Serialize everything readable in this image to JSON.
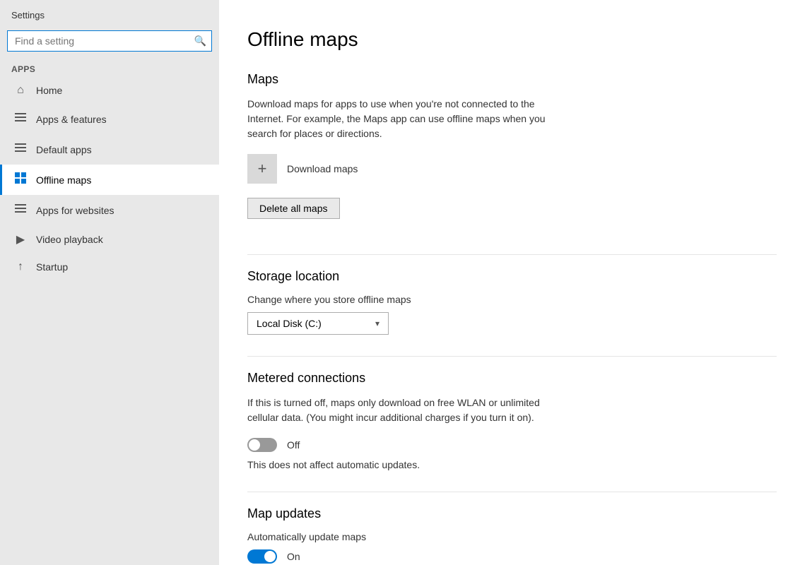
{
  "app": {
    "title": "Settings"
  },
  "sidebar": {
    "search_placeholder": "Find a setting",
    "section_label": "Apps",
    "items": [
      {
        "id": "home",
        "label": "Home",
        "icon": "⌂"
      },
      {
        "id": "apps-features",
        "label": "Apps & features",
        "icon": "☰"
      },
      {
        "id": "default-apps",
        "label": "Default apps",
        "icon": "☰"
      },
      {
        "id": "offline-maps",
        "label": "Offline maps",
        "icon": "⊞",
        "active": true
      },
      {
        "id": "apps-websites",
        "label": "Apps for websites",
        "icon": "☰"
      },
      {
        "id": "video-playback",
        "label": "Video playback",
        "icon": "▶"
      },
      {
        "id": "startup",
        "label": "Startup",
        "icon": "↑"
      }
    ]
  },
  "main": {
    "page_title": "Offline maps",
    "maps_section": {
      "title": "Maps",
      "description": "Download maps for apps to use when you're not connected to the Internet. For example, the Maps app can use offline maps when you search for places or directions.",
      "download_label": "Download maps",
      "delete_label": "Delete all maps"
    },
    "storage_section": {
      "title": "Storage location",
      "change_label": "Change where you store offline maps",
      "dropdown_value": "Local Disk (C:)"
    },
    "metered_section": {
      "title": "Metered connections",
      "description": "If this is turned off, maps only download on free WLAN or unlimited cellular data. (You might incur additional charges if you turn it on).",
      "toggle_state": "off",
      "toggle_label": "Off",
      "note": "This does not affect automatic updates."
    },
    "updates_section": {
      "title": "Map updates",
      "auto_label": "Automatically update maps",
      "toggle_state": "on",
      "toggle_label": "On"
    }
  }
}
